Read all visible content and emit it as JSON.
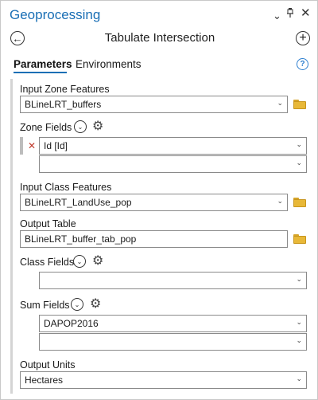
{
  "header": {
    "title": "Geoprocessing",
    "menu_icon": "⌄",
    "pin_icon": "ᵖ",
    "close_icon": "✕"
  },
  "toolbar": {
    "back_icon": "←",
    "tool_title": "Tabulate Intersection",
    "add_icon": "+"
  },
  "tabs": {
    "parameters": "Parameters",
    "environments": "Environments",
    "help_icon": "?"
  },
  "params": {
    "input_zone_features": {
      "label": "Input Zone Features",
      "value": "BLineLRT_buffers"
    },
    "zone_fields": {
      "label": "Zone Fields",
      "rows": [
        "Id [Id]",
        ""
      ]
    },
    "input_class_features": {
      "label": "Input Class Features",
      "value": "BLineLRT_LandUse_pop"
    },
    "output_table": {
      "label": "Output Table",
      "value": "BLineLRT_buffer_tab_pop"
    },
    "class_fields": {
      "label": "Class Fields",
      "rows": [
        ""
      ]
    },
    "sum_fields": {
      "label": "Sum Fields",
      "rows": [
        "DAPOP2016",
        ""
      ]
    },
    "output_units": {
      "label": "Output Units",
      "value": "Hectares"
    }
  },
  "glyphs": {
    "chevron": "⌄",
    "expand": "⌄",
    "gear": "⚙",
    "remove": "✕"
  },
  "colors": {
    "accent": "#1a6fb5",
    "folder": "#e8b838",
    "remove": "#c0392b"
  }
}
